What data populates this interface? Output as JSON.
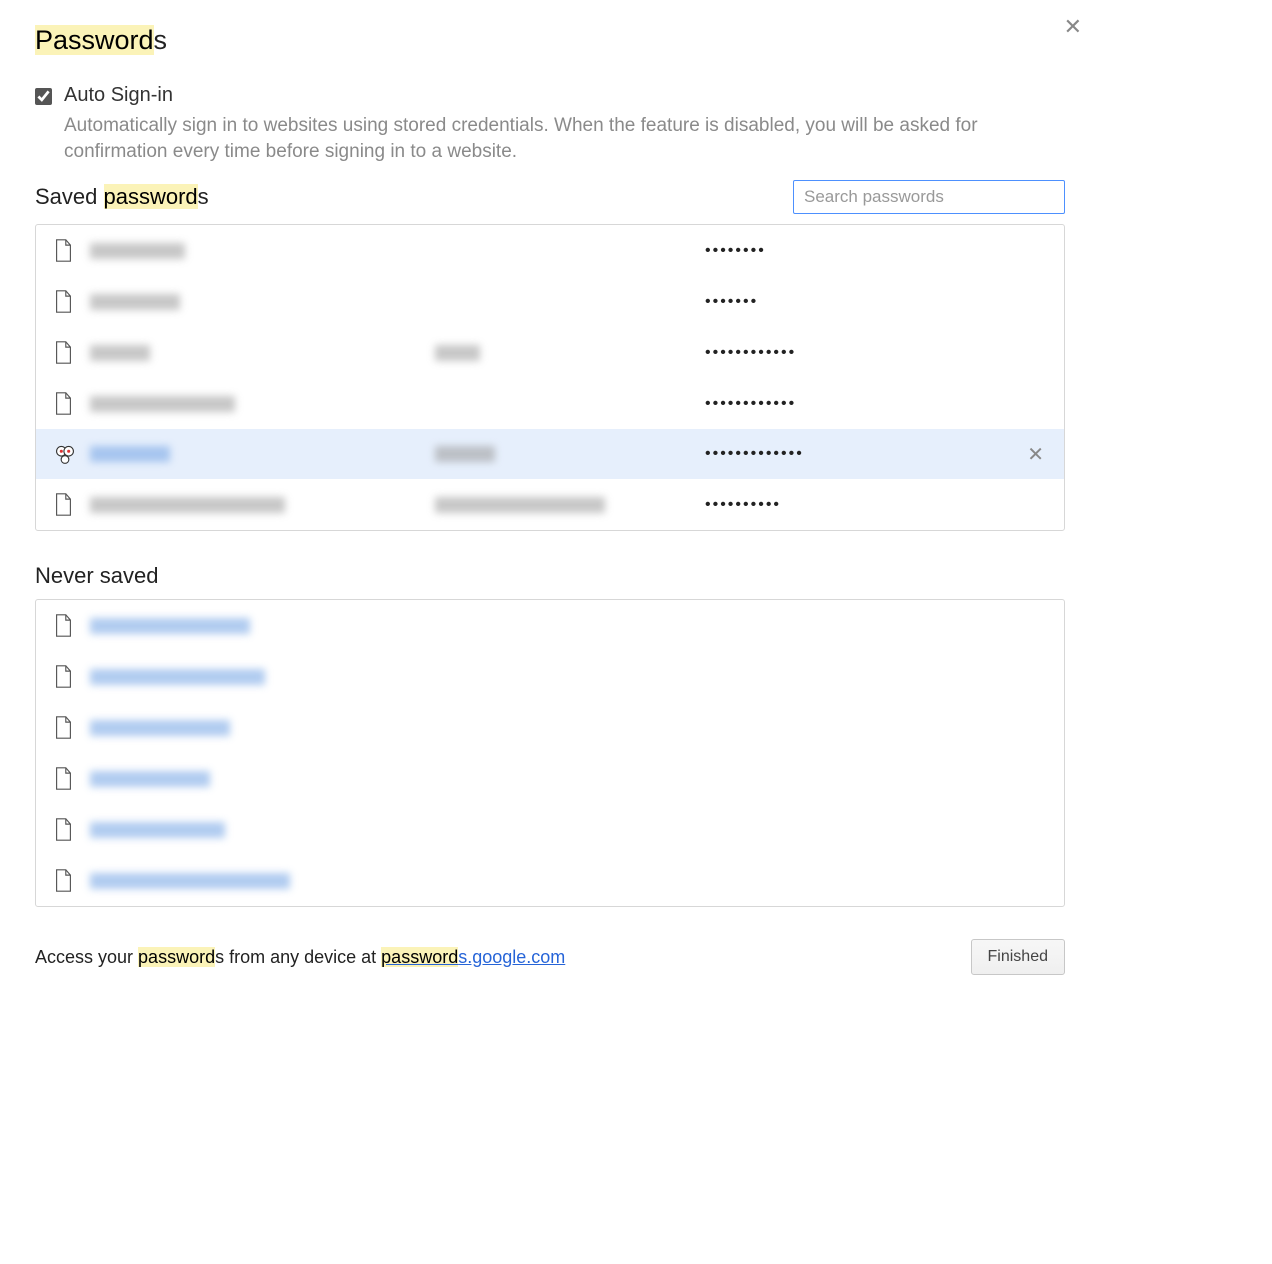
{
  "title_highlight": "Password",
  "title_suffix": "s",
  "close_icon": "✕",
  "auto_signin": {
    "checked": true,
    "label": "Auto Sign-in",
    "description": "Automatically sign in to websites using stored credentials. When the feature is disabled, you will be asked for confirmation every time before signing in to a website."
  },
  "saved_section": {
    "title_prefix": "Saved ",
    "title_highlight": "password",
    "title_suffix": "s",
    "search_placeholder": "Search passwords"
  },
  "saved_rows": [
    {
      "site_len": 95,
      "user_len": 0,
      "dots": "••••••••",
      "favicon": false,
      "selected": false
    },
    {
      "site_len": 90,
      "user_len": 0,
      "dots": "•••••••",
      "favicon": false,
      "selected": false
    },
    {
      "site_len": 60,
      "user_len": 45,
      "dots": "••••••••••••",
      "favicon": false,
      "selected": false
    },
    {
      "site_len": 145,
      "user_len": 0,
      "dots": "••••••••••••",
      "favicon": false,
      "selected": false
    },
    {
      "site_len": 80,
      "user_len": 60,
      "dots": "•••••••••••••",
      "favicon": true,
      "selected": true
    },
    {
      "site_len": 195,
      "user_len": 170,
      "dots": "••••••••••",
      "favicon": false,
      "selected": false
    }
  ],
  "never_section": {
    "title": "Never saved"
  },
  "never_rows": [
    {
      "site_len": 160
    },
    {
      "site_len": 175
    },
    {
      "site_len": 140
    },
    {
      "site_len": 120
    },
    {
      "site_len": 135
    },
    {
      "site_len": 200
    }
  ],
  "footer": {
    "text_prefix": "Access your ",
    "text_highlight": "password",
    "text_mid": "s from any device at ",
    "link_highlight": "password",
    "link_suffix": "s.google.com",
    "button": "Finished"
  }
}
